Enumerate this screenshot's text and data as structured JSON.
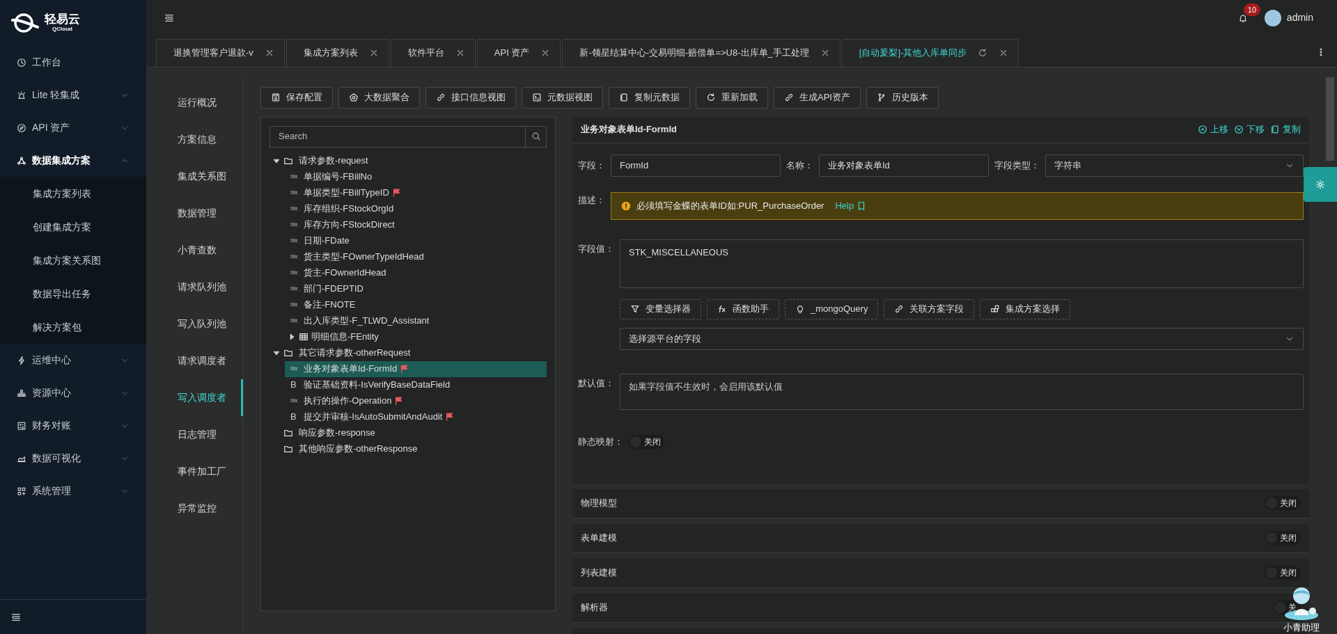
{
  "brand": {
    "name": "轻易云",
    "sub": "QCloud"
  },
  "header": {
    "notifications": "10",
    "user": "admin"
  },
  "tabs": [
    {
      "label": "退换管理客户退款-v",
      "selected": false
    },
    {
      "label": "集成方案列表",
      "selected": false
    },
    {
      "label": "软件平台",
      "selected": false
    },
    {
      "label": "API 资产",
      "selected": false
    },
    {
      "label": "新-领星结算中心-交易明细-赔偿单=>U8-出库单_手工处理",
      "selected": false
    },
    {
      "label": "[自动爰梨]-其他入库单同步",
      "selected": true
    }
  ],
  "sidebar": {
    "items": [
      {
        "label": "工作台",
        "kind": "clock"
      },
      {
        "label": "Lite 轻集成",
        "kind": "alarm",
        "expanded": false
      },
      {
        "label": "API 资产",
        "kind": "compass",
        "expanded": false
      },
      {
        "label": "数据集成方案",
        "kind": "nodes",
        "expanded": true,
        "children": [
          {
            "label": "集成方案列表"
          },
          {
            "label": "创建集成方案"
          },
          {
            "label": "集成方案关系图"
          },
          {
            "label": "数据导出任务"
          },
          {
            "label": "解决方案包"
          }
        ]
      },
      {
        "label": "运维中心",
        "kind": "bolt",
        "expanded": false
      },
      {
        "label": "资源中心",
        "kind": "sitemap",
        "expanded": false
      },
      {
        "label": "财务对账",
        "kind": "calc",
        "expanded": false
      },
      {
        "label": "数据可视化",
        "kind": "chart",
        "expanded": false
      },
      {
        "label": "系统管理",
        "kind": "apps",
        "expanded": false
      }
    ]
  },
  "subnav": [
    {
      "label": "运行概况",
      "selected": false
    },
    {
      "label": "方案信息",
      "selected": false
    },
    {
      "label": "集成关系图",
      "selected": false
    },
    {
      "label": "数据管理",
      "selected": false
    },
    {
      "label": "小青查数",
      "selected": false
    },
    {
      "label": "请求队列池",
      "selected": false
    },
    {
      "label": "写入队列池",
      "selected": false
    },
    {
      "label": "请求调度者",
      "selected": false
    },
    {
      "label": "写入调度者",
      "selected": true
    },
    {
      "label": "日志管理",
      "selected": false
    },
    {
      "label": "事件加工厂",
      "selected": false
    },
    {
      "label": "异常监控",
      "selected": false
    }
  ],
  "toolbar": [
    {
      "label": "保存配置",
      "kind": "save"
    },
    {
      "label": "大数据聚合",
      "kind": "aggregate"
    },
    {
      "label": "接口信息视图",
      "kind": "link"
    },
    {
      "label": "元数据视图",
      "kind": "console"
    },
    {
      "label": "复制元数据",
      "kind": "copy"
    },
    {
      "label": "重新加载",
      "kind": "reload"
    },
    {
      "label": "生成API资产",
      "kind": "link"
    },
    {
      "label": "历史版本",
      "kind": "branch"
    }
  ],
  "tree": {
    "search": {
      "placeholder": "Search"
    },
    "nodes": [
      {
        "label": "请求参数-request",
        "kind": "folder",
        "expanded": true,
        "children": [
          {
            "label": "单据编号-FBillNo",
            "kind": "field",
            "type_label": "Str.",
            "flagged": false,
            "selected": false
          },
          {
            "label": "单据类型-FBillTypeID",
            "kind": "field",
            "type_label": "Str.",
            "flagged": true,
            "selected": false
          },
          {
            "label": "库存组织-FStockOrgId",
            "kind": "field",
            "type_label": "Str.",
            "flagged": false,
            "selected": false
          },
          {
            "label": "库存方向-FStockDirect",
            "kind": "field",
            "type_label": "Str.",
            "flagged": false,
            "selected": false
          },
          {
            "label": "日期-FDate",
            "kind": "field",
            "type_label": "Str.",
            "flagged": false,
            "selected": false
          },
          {
            "label": "货主类型-FOwnerTypeIdHead",
            "kind": "field",
            "type_label": "Str.",
            "flagged": false,
            "selected": false
          },
          {
            "label": "货主-FOwnerIdHead",
            "kind": "field",
            "type_label": "Str.",
            "flagged": false,
            "selected": false
          },
          {
            "label": "部门-FDEPTID",
            "kind": "field",
            "type_label": "Str.",
            "flagged": false,
            "selected": false
          },
          {
            "label": "备注-FNOTE",
            "kind": "field",
            "type_label": "Str.",
            "flagged": false,
            "selected": false
          },
          {
            "label": "出入库类型-F_TLWD_Assistant",
            "kind": "field",
            "type_label": "Str.",
            "flagged": false,
            "selected": false
          },
          {
            "label": "明细信息-FEntity",
            "kind": "table",
            "expanded": false
          }
        ]
      },
      {
        "label": "其它请求参数-otherRequest",
        "kind": "folder",
        "expanded": true,
        "children": [
          {
            "label": "业务对象表单Id-FormId",
            "kind": "field",
            "type_label": "Str.",
            "flagged": true,
            "selected": true
          },
          {
            "label": "验证基础资料-IsVerifyBaseDataField",
            "kind": "field",
            "type_label": "B",
            "flagged": false,
            "selected": false
          },
          {
            "label": "执行的操作-Operation",
            "kind": "field",
            "type_label": "Str.",
            "flagged": true,
            "selected": false
          },
          {
            "label": "提交并审核-IsAutoSubmitAndAudit",
            "kind": "field",
            "type_label": "B",
            "flagged": true,
            "selected": false
          }
        ]
      },
      {
        "label": "响应参数-response",
        "kind": "folder"
      },
      {
        "label": "其他响应参数-otherResponse",
        "kind": "folder"
      }
    ]
  },
  "detail": {
    "title": "业务对象表单Id-FormId",
    "actions": [
      {
        "label": "上移",
        "kind": "up"
      },
      {
        "label": "下移",
        "kind": "down"
      },
      {
        "label": "复制",
        "kind": "copy"
      }
    ],
    "field": {
      "label": "字段：",
      "value": "FormId"
    },
    "name": {
      "label": "名称：",
      "value": "业务对象表单Id"
    },
    "type": {
      "label": "字段类型：",
      "value": "字符串"
    },
    "description": {
      "label": "描述：",
      "text": "必须填写金蝶的表单ID如:PUR_PurchaseOrder",
      "link": "Help"
    },
    "value": {
      "label": "字段值：",
      "value": "STK_MISCELLANEOUS"
    },
    "helpers": [
      {
        "label": "变量选择器",
        "kind": "filter"
      },
      {
        "label": "函数助手",
        "kind": "fx"
      },
      {
        "label": "_mongoQuery",
        "kind": "bulb"
      },
      {
        "label": "关联方案字段",
        "kind": "link"
      },
      {
        "label": "集成方案选择",
        "kind": "blocks"
      }
    ],
    "source": {
      "placeholder": "选择源平台的字段"
    },
    "default": {
      "label": "默认值：",
      "placeholder": "如果字段值不生效时，会启用该默认值"
    },
    "static_mapping": {
      "label": "静态映射：",
      "on": false,
      "state": "关闭"
    }
  },
  "sections": [
    {
      "title": "物理模型",
      "on": false,
      "state": "关闭"
    },
    {
      "title": "表单建模",
      "on": false,
      "state": "关闭"
    },
    {
      "title": "列表建模",
      "on": false,
      "state": "关闭"
    },
    {
      "title": "解析器",
      "on": false,
      "state": "关"
    }
  ],
  "assistant": {
    "label": "小青助理"
  }
}
